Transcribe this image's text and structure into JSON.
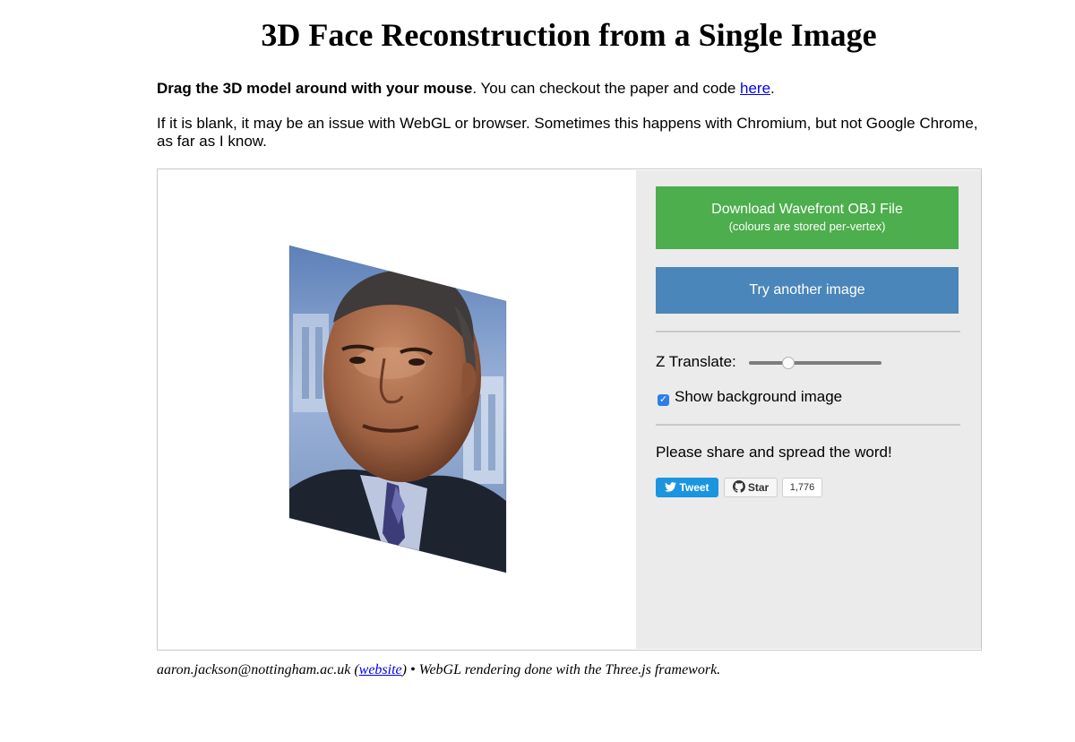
{
  "page": {
    "title": "3D Face Reconstruction from a Single Image"
  },
  "intro": {
    "bold": "Drag the 3D model around with your mouse",
    "text": ". You can checkout the paper and code ",
    "link": "here",
    "end": "."
  },
  "warning": "If it is blank, it may be an issue with WebGL or browser. Sometimes this happens with Chromium, but not Google Chrome, as far as I know.",
  "panel": {
    "download_label": "Download Wavefront OBJ File",
    "download_sub": "(colours are stored per-vertex)",
    "try_label": "Try another image",
    "z_translate_label": "Z Translate:",
    "z_translate_value": 0.3,
    "show_bg_label": "Show background image",
    "show_bg_checked": true,
    "share_text": "Please share and spread the word!",
    "tweet_label": "Tweet",
    "star_label": "Star",
    "star_count": "1,776"
  },
  "footer": {
    "email": "aaron.jackson@nottingham.ac.uk",
    "open_paren": " (",
    "website_link": "website",
    "rest": ") • WebGL rendering done with the Three.js framework."
  },
  "colors": {
    "download_button": "#4cae4c",
    "try_button": "#4a86b9",
    "panel_bg": "#ebebeb",
    "tweet_button": "#1b95e0",
    "checkbox": "#2a7fe8"
  },
  "icons": {
    "tweet": "twitter-bird-icon",
    "star": "github-octocat-icon",
    "checkbox": "checkmark-icon"
  }
}
